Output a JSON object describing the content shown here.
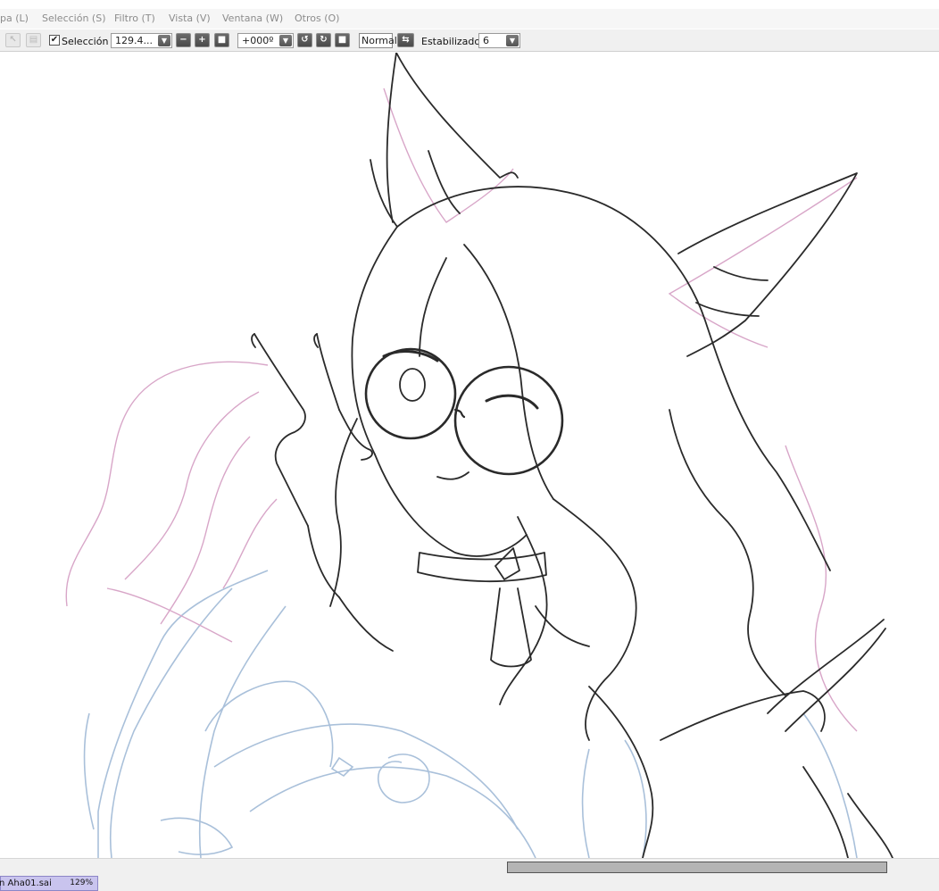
{
  "menu": {
    "items": [
      "pa (L)",
      "Selección (S)",
      "Filtro (T)",
      "Vista (V)",
      "Ventana (W)",
      "Otros (O)"
    ]
  },
  "toolbar": {
    "selection_checked": true,
    "selection_label": "Selección",
    "zoom_value": "129.4...",
    "rotation_value": "+000º",
    "blend_mode": "Normal",
    "stabilizer_label": "Estabilizador",
    "stabilizer_value": "6"
  },
  "status": {
    "file_name": "n  Aha01.sai",
    "zoom": "129%"
  },
  "colors": {
    "line_art": "#2a2a2a",
    "sketch_pink": "#d8a6c8",
    "sketch_blue": "#a9c0da",
    "file_tab": "#c9c4ee"
  }
}
